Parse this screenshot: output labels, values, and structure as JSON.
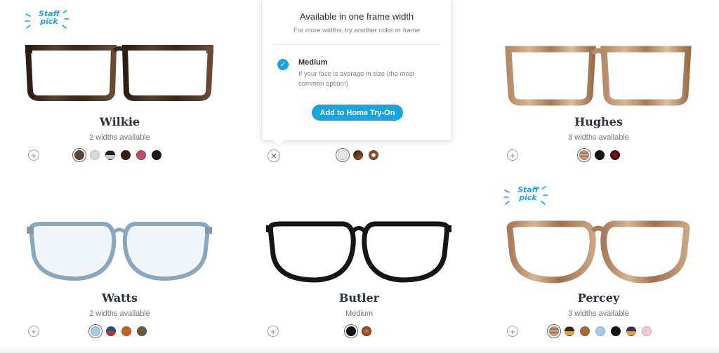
{
  "products": [
    {
      "name": "Wilkie",
      "widths": "2 widths available",
      "staff_pick": true,
      "staff_pick_text": "Staff pick",
      "frame_style": "rect-tortoise-dark",
      "swatches": [
        "#5a4738",
        "#d8d8d8",
        "#1e2328",
        "#3a1f16",
        "#b94e6b",
        "#1b1b1b"
      ]
    },
    {
      "name": "",
      "widths": "",
      "staff_pick": false,
      "frame_style": "hidden",
      "swatches": [
        "#e6e6e6",
        "#7a3a1e",
        "#8a4e2a"
      ]
    },
    {
      "name": "Hughes",
      "widths": "3 widths available",
      "staff_pick": false,
      "frame_style": "square-light-tortoise",
      "swatches": [
        "#c4a28a",
        "#151515",
        "#5e0f12"
      ]
    },
    {
      "name": "Watts",
      "widths": "2 widths available",
      "staff_pick": false,
      "frame_style": "round-crystal-blue",
      "swatches": [
        "#a9cbe0",
        "#b63a2a",
        "#c0631e",
        "#6b5a3e"
      ]
    },
    {
      "name": "Butler",
      "widths": "Medium",
      "staff_pick": false,
      "frame_style": "round-black",
      "swatches": [
        "#141414",
        "#b45a18"
      ]
    },
    {
      "name": "Percey",
      "widths": "3 widths available",
      "staff_pick": true,
      "staff_pick_text": "Staff pick",
      "frame_style": "round-light-tortoise",
      "swatches": [
        "#c2a187",
        "#3a2316",
        "#a26a3c",
        "#a7cbe6",
        "#141414",
        "#3a2a6a",
        "#f2c9cf"
      ]
    }
  ],
  "popover": {
    "title": "Available in one frame width",
    "subtitle": "For more widths, try another color or frame",
    "option_title": "Medium",
    "option_desc": "If your face is average in size (the most common option!)",
    "button_label": "Add to Home Try-On"
  },
  "colors": {
    "accent": "#1aa4dd",
    "text": "#414b56"
  }
}
